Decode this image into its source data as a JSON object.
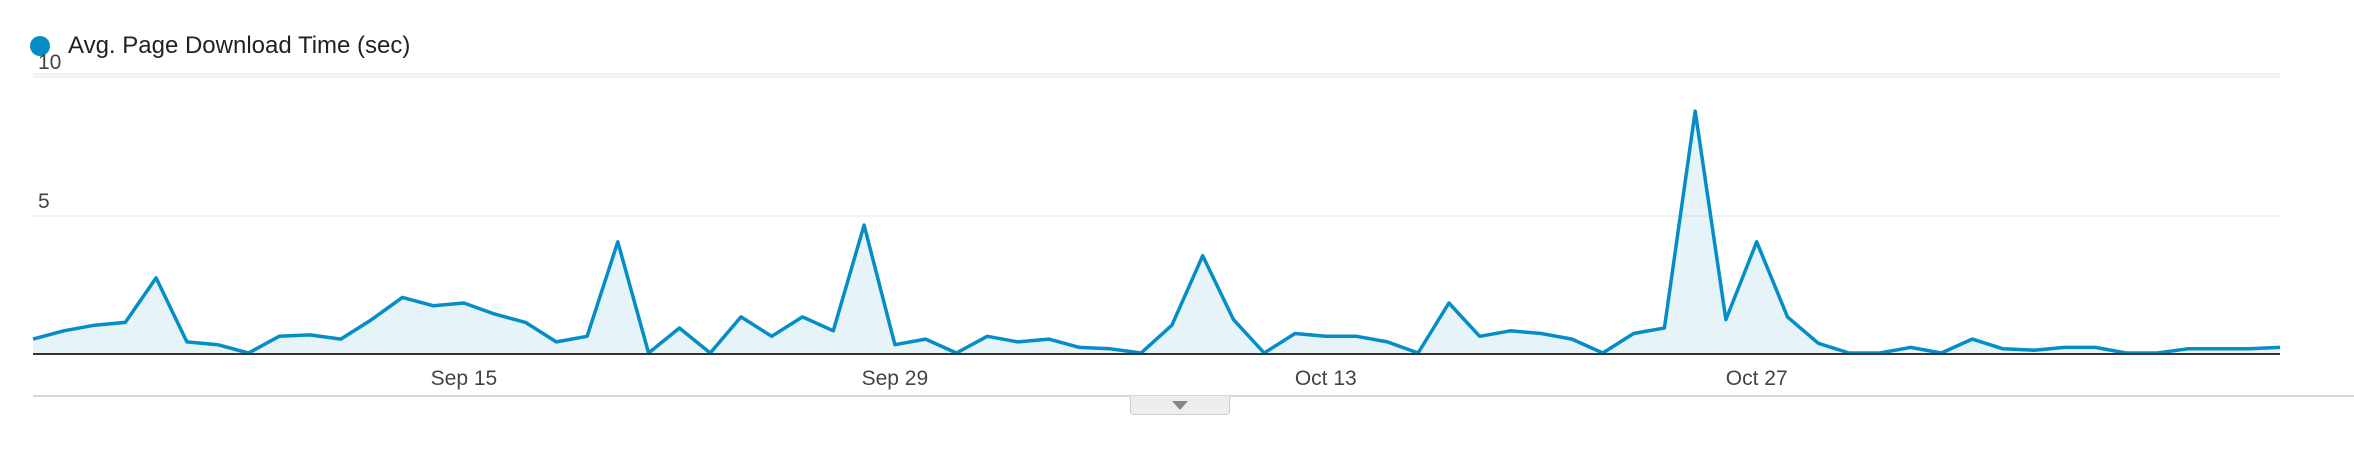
{
  "legend": {
    "label": "Avg. Page Download Time (sec)",
    "color": "#058dc7"
  },
  "scroll_icon": "chevron-down-icon",
  "chart_data": {
    "type": "area",
    "series": [
      {
        "name": "Avg. Page Download Time (sec)",
        "color": "#058dc7",
        "values": [
          0.5,
          0.8,
          1.0,
          1.1,
          2.7,
          0.4,
          0.3,
          0.0,
          0.6,
          0.65,
          0.5,
          1.2,
          2.0,
          1.7,
          1.8,
          1.4,
          1.1,
          0.4,
          0.6,
          4.0,
          0.0,
          0.9,
          0.0,
          1.3,
          0.6,
          1.3,
          0.8,
          4.6,
          0.3,
          0.5,
          0.0,
          0.6,
          0.4,
          0.5,
          0.2,
          0.15,
          0.0,
          1.0,
          3.5,
          1.2,
          0.0,
          0.7,
          0.6,
          0.6,
          0.4,
          0.0,
          1.8,
          0.6,
          0.8,
          0.7,
          0.5,
          0.0,
          0.7,
          0.9,
          8.7,
          1.2,
          4.0,
          1.3,
          0.35,
          0.0,
          0.0,
          0.2,
          0.0,
          0.5,
          0.15,
          0.1,
          0.2,
          0.2,
          0.0,
          0.0,
          0.15,
          0.15,
          0.15,
          0.2
        ]
      }
    ],
    "x_tick_labels": [
      {
        "label": "Sep 15",
        "index": 14
      },
      {
        "label": "Sep 29",
        "index": 28
      },
      {
        "label": "Oct 13",
        "index": 42
      },
      {
        "label": "Oct 27",
        "index": 56
      }
    ],
    "y_ticks": [
      10,
      5
    ],
    "ylim": [
      0,
      10
    ],
    "grid": true,
    "legend_position": "top-left"
  }
}
